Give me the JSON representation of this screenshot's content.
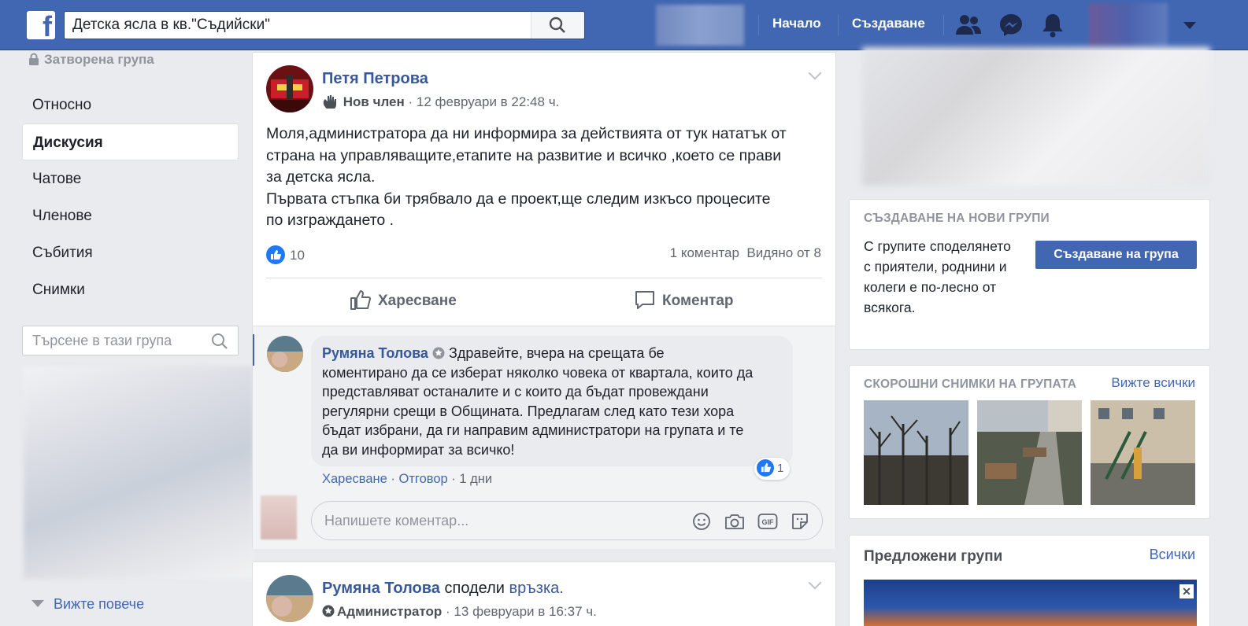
{
  "topbar": {
    "logo": "f",
    "search_value": "Детска ясла в кв.\"Съдийски\"",
    "nav_home": "Начало",
    "nav_create": "Създаване"
  },
  "left": {
    "closed_group": "Затворена група",
    "nav": [
      "Относно",
      "Дискусия",
      "Чатове",
      "Членове",
      "Събития",
      "Снимки"
    ],
    "active_index": 1,
    "search_placeholder": "Търсене в тази група",
    "see_more": "Вижте повече"
  },
  "post": {
    "author": "Петя Петрова",
    "badge": "Нов член",
    "timestamp": "· 12 февруари в 22:48 ч.",
    "body_lines": [
      "Моля,администратора да ни информира за действията от тук нататък от",
      "страна на управляващите,етапите на развитие и всичко ,което се прави",
      "за детска ясла.",
      "Първата стъпка би трябвало да е проект,ще следим изкъсо процесите",
      "по изграждането ."
    ],
    "like_count": "10",
    "comment_count": "1 коментар",
    "seen_by": "Видяно от 8",
    "like_action": "Харесване",
    "comment_action": "Коментар"
  },
  "comment": {
    "author": "Румяна Толова",
    "text_lines": [
      "Здравейте, вчера на срещата бе",
      "коментирано да се изберат няколко човека от квартала, които да",
      "представляват останалите и с които да бъдат провеждани",
      "регулярни срещи в Общината. Предлагам след като тези хора",
      "бъдат избрани, да ги направим администратори на групата и те",
      "да ви информират за всичко!"
    ],
    "reaction_count": "1",
    "like_link": "Харесване",
    "reply_link": "Отговор",
    "age": "· 1 дни"
  },
  "write_comment": {
    "placeholder": "Напишете коментар..."
  },
  "post2": {
    "author": "Румяна Толова",
    "action": "сподели",
    "object": "връзка.",
    "badge": "Администратор",
    "timestamp": "· 13 февруари в 16:37 ч."
  },
  "right": {
    "create_title": "СЪЗДАВАНЕ НА НОВИ ГРУПИ",
    "create_text": "С групите споделянето с приятели, роднини и колеги е по-лесно от всякога.",
    "create_button": "Създаване на група",
    "photos_title": "СКОРОШНИ СНИМКИ НА ГРУПАТА",
    "photos_link": "Вижте всички",
    "suggested_title": "Предложени групи",
    "suggested_link": "Всички",
    "close": "✕"
  },
  "colors": {
    "brand": "#4267b2",
    "link": "#385898",
    "like_blue": "#2078f4"
  },
  "icons": [
    "facebook-logo",
    "search-icon",
    "friends-icon",
    "messenger-icon",
    "bell-icon",
    "caret-down-icon",
    "lock-icon",
    "wave-icon",
    "thumbs-up-icon",
    "comment-icon",
    "admin-badge-icon",
    "emoji-icon",
    "camera-icon",
    "gif-icon",
    "sticker-icon"
  ]
}
